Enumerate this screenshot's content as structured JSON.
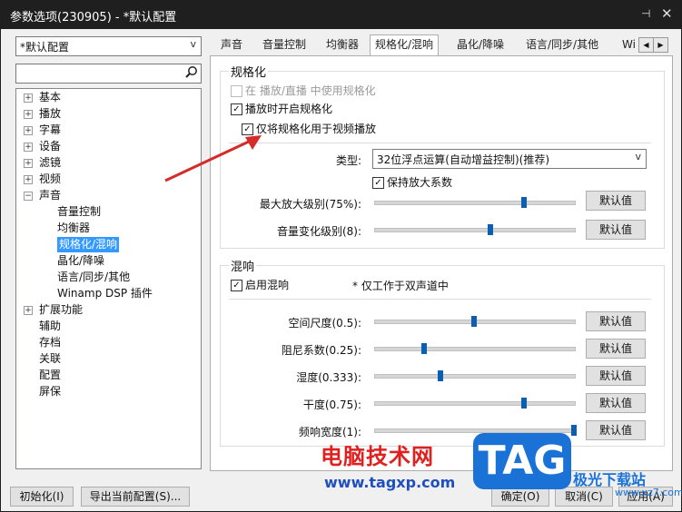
{
  "window": {
    "title": "参数选项(230905) - *默认配置",
    "pin_glyph": "⊣",
    "close_glyph": "✕"
  },
  "profile": {
    "selected": "*默认配置",
    "arrow": "v"
  },
  "search": {
    "placeholder": ""
  },
  "tree": {
    "items": [
      {
        "label": "基本",
        "expander": "+"
      },
      {
        "label": "播放",
        "expander": "+"
      },
      {
        "label": "字幕",
        "expander": "+"
      },
      {
        "label": "设备",
        "expander": "+"
      },
      {
        "label": "滤镜",
        "expander": "+"
      },
      {
        "label": "视频",
        "expander": "+"
      },
      {
        "label": "声音",
        "expander": "−"
      },
      {
        "label": "音量控制"
      },
      {
        "label": "均衡器"
      },
      {
        "label": "规格化/混响"
      },
      {
        "label": "晶化/降噪"
      },
      {
        "label": "语言/同步/其他"
      },
      {
        "label": "Winamp DSP 插件"
      },
      {
        "label": "扩展功能",
        "expander": "+"
      },
      {
        "label": "辅助"
      },
      {
        "label": "存档"
      },
      {
        "label": "关联"
      },
      {
        "label": "配置"
      },
      {
        "label": "屏保"
      }
    ]
  },
  "tabs": [
    "声音",
    "音量控制",
    "均衡器",
    "规格化/混响",
    "晶化/降噪",
    "语言/同步/其他",
    "Wi"
  ],
  "tab_scroll": {
    "left": "◀",
    "right": "▶"
  },
  "normalize": {
    "group_title": "规格化",
    "cb_live": "在 播放/直播 中使用规格化",
    "cb_enable": "播放时开启规格化",
    "cb_video_only": "仅将规格化用于视频播放",
    "type_label": "类型:",
    "type_value": "32位浮点运算(自动增益控制)(推荐)",
    "type_arrow": "v",
    "cb_keep": "保持放大系数",
    "max_amp_label": "最大放大级别(75%):",
    "max_amp_value": 0.75,
    "vol_change_label": "音量变化级别(8):",
    "vol_change_value": 0.58,
    "default_btn": "默认值"
  },
  "reverb": {
    "group_title": "混响",
    "cb_enable": "启用混响",
    "note": "* 仅工作于双声道中",
    "rows": [
      {
        "label": "空间尺度(0.5):",
        "value": 0.5
      },
      {
        "label": "阻尼系数(0.25):",
        "value": 0.25
      },
      {
        "label": "湿度(0.333):",
        "value": 0.333
      },
      {
        "label": "干度(0.75):",
        "value": 0.75
      },
      {
        "label": "频响宽度(1):",
        "value": 1.0
      }
    ],
    "default_btn": "默认值"
  },
  "bottom": {
    "init": "初始化(I)",
    "export": "导出当前配置(S)...",
    "ok": "确定(O)",
    "cancel": "取消(C)",
    "apply": "应用(A)"
  },
  "check_glyph": "✓",
  "search_icon": "magnifier-icon",
  "watermark": {
    "line1": "电脑技术网",
    "line2": "www.tagxp.com",
    "logo": "TAG",
    "site_cn": "极光下载站",
    "site_url": "www.xz7.com"
  },
  "colors": {
    "titlebar": "#1f1f1f",
    "selection": "#3399ff",
    "slider_thumb": "#0c5fb0",
    "arrow": "#d62b2b"
  }
}
